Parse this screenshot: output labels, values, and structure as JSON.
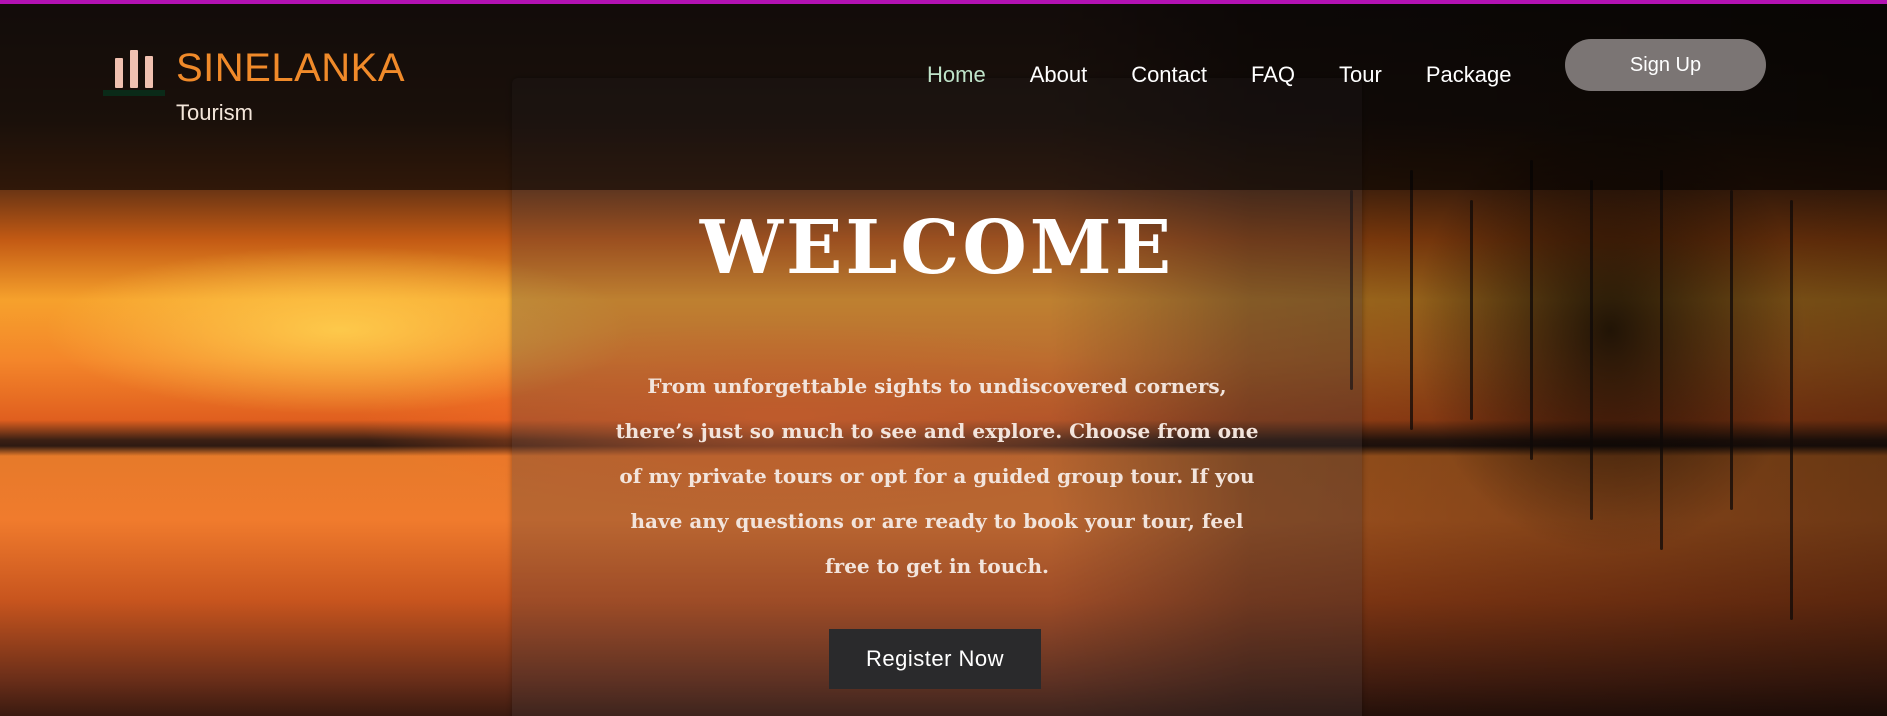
{
  "brand": {
    "title": "SINELANKA",
    "subtitle": "Tourism",
    "logo_icon": "candles-logo-icon"
  },
  "nav": {
    "items": [
      {
        "label": "Home",
        "active": true
      },
      {
        "label": "About",
        "active": false
      },
      {
        "label": "Contact",
        "active": false
      },
      {
        "label": "FAQ",
        "active": false
      },
      {
        "label": "Tour",
        "active": false
      },
      {
        "label": "Package",
        "active": false
      }
    ],
    "signup_label": "Sign Up"
  },
  "hero": {
    "title": "WELCOME",
    "text": "From unforgettable sights to undiscovered corners, there’s just so much to see and explore. Choose from one of my private tours or opt for a guided group tour. If you have any questions or are ready to book your tour, feel free to get in touch.",
    "cta_label": "Register Now"
  },
  "colors": {
    "top_border": "#b312b3",
    "brand_orange": "#f08a2a",
    "nav_active": "#bfe3c9",
    "signup_bg": "#7b7574",
    "cta_bg": "#2a2a2c"
  }
}
